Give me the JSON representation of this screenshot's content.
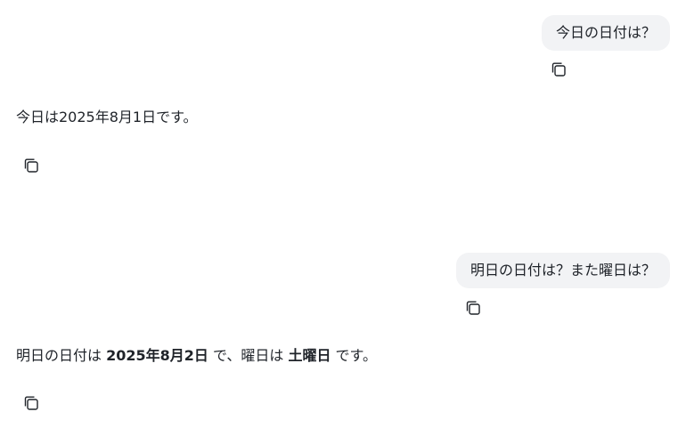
{
  "conversation": {
    "messages": [
      {
        "role": "user",
        "text": "今日の日付は？",
        "copy_icon": "copy-icon"
      },
      {
        "role": "assistant",
        "text": "今日は2025年8月1日です。",
        "copy_icon": "copy-icon"
      },
      {
        "role": "user",
        "text": "明日の日付は？また曜日は？",
        "copy_icon": "copy-icon"
      },
      {
        "role": "assistant",
        "segments": [
          {
            "text": "明日の日付は ",
            "bold": false
          },
          {
            "text": "2025年8月2日",
            "bold": true
          },
          {
            "text": " で、曜日は ",
            "bold": false
          },
          {
            "text": "土曜日",
            "bold": true
          },
          {
            "text": " です。",
            "bold": false
          }
        ],
        "copy_icon": "copy-icon"
      }
    ]
  }
}
